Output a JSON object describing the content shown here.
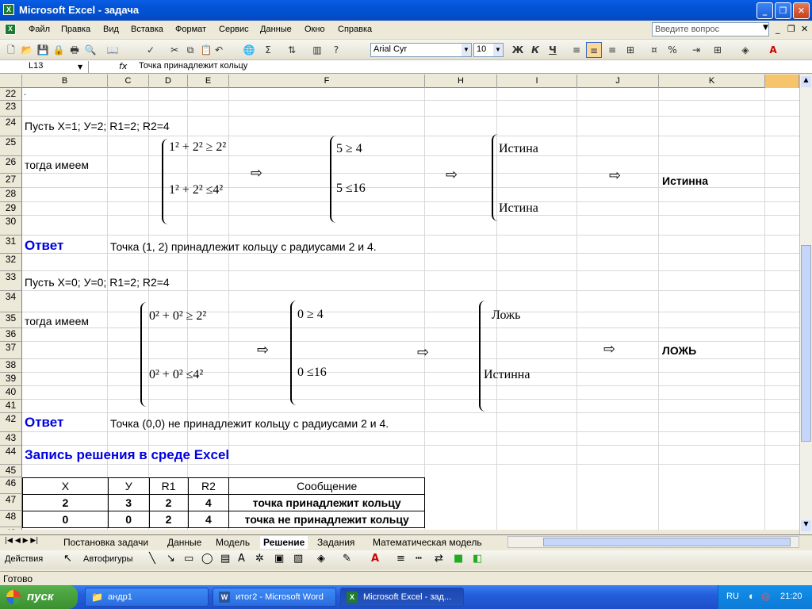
{
  "window": {
    "title": "Microsoft Excel - задача",
    "app_icon": "excel-icon"
  },
  "menu": {
    "items": [
      "Файл",
      "Правка",
      "Вид",
      "Вставка",
      "Формат",
      "Сервис",
      "Данные",
      "Окно",
      "Справка"
    ],
    "ask_placeholder": "Введите вопрос"
  },
  "toolbar": {
    "font": "Arial Cyr",
    "size": "10"
  },
  "formula": {
    "cell": "L13",
    "fx": "fx",
    "value": "Точка принадлежит кольцу"
  },
  "columns": [
    "B",
    "C",
    "D",
    "E",
    "F",
    "H",
    "I",
    "J",
    "K"
  ],
  "rows": [
    "22",
    "23",
    "24",
    "25",
    "26",
    "27",
    "28",
    "29",
    "30",
    "31",
    "32",
    "33",
    "34",
    "35",
    "36",
    "37",
    "38",
    "39",
    "40",
    "41",
    "42",
    "43",
    "44",
    "45",
    "46",
    "47",
    "48",
    "49"
  ],
  "sheet": {
    "r22_mark": ".",
    "ex1": {
      "given": "Пусть X=1;  У=2; R1=2; R2=4",
      "then": "тогда имеем",
      "f1": "1² + 2² ≥ 2²",
      "f2": "1² + 2² ≤4²",
      "s1": "5 ≥ 4",
      "s2": "5 ≤16",
      "t1": "Истина",
      "t2": "Истина",
      "result": "Истинна",
      "answer_label": "Ответ",
      "answer_text": "Точка (1, 2) принадлежит кольцу с радиусами 2 и 4."
    },
    "ex2": {
      "given": "Пусть X=0;  У=0; R1=2; R2=4",
      "then": "тогда имеем",
      "f1": "0² + 0² ≥ 2²",
      "f2": "0² + 0² ≤4²",
      "s1": "0 ≥ 4",
      "s2": "0 ≤16",
      "t1": "Ложь",
      "t2": "Истинна",
      "result": "ЛОЖЬ",
      "answer_label": "Ответ",
      "answer_text": "Точка (0,0)  не принадлежит кольцу с радиусами 2 и 4."
    },
    "excel_heading": "Запись решения в среде Excel",
    "table": {
      "headers": [
        "X",
        "У",
        "R1",
        "R2",
        "Сообщение"
      ],
      "rows": [
        [
          "2",
          "3",
          "2",
          "4",
          "точка принадлежит кольцу"
        ],
        [
          "0",
          "0",
          "2",
          "4",
          "точка не принадлежит кольцу"
        ]
      ]
    }
  },
  "tabs": [
    "Постановка задачи",
    "Данные",
    "Модель",
    "Решение",
    "Задания",
    "Математическая модель"
  ],
  "active_tab": "Решение",
  "drawbar": {
    "actions": "Действия",
    "autoshapes": "Автофигуры"
  },
  "status": "Готово",
  "taskbar": {
    "start": "пуск",
    "tasks": [
      "андр1",
      "итог2 - Microsoft Word",
      "Microsoft Excel - зад..."
    ],
    "lang": "RU",
    "time": "21:20"
  }
}
